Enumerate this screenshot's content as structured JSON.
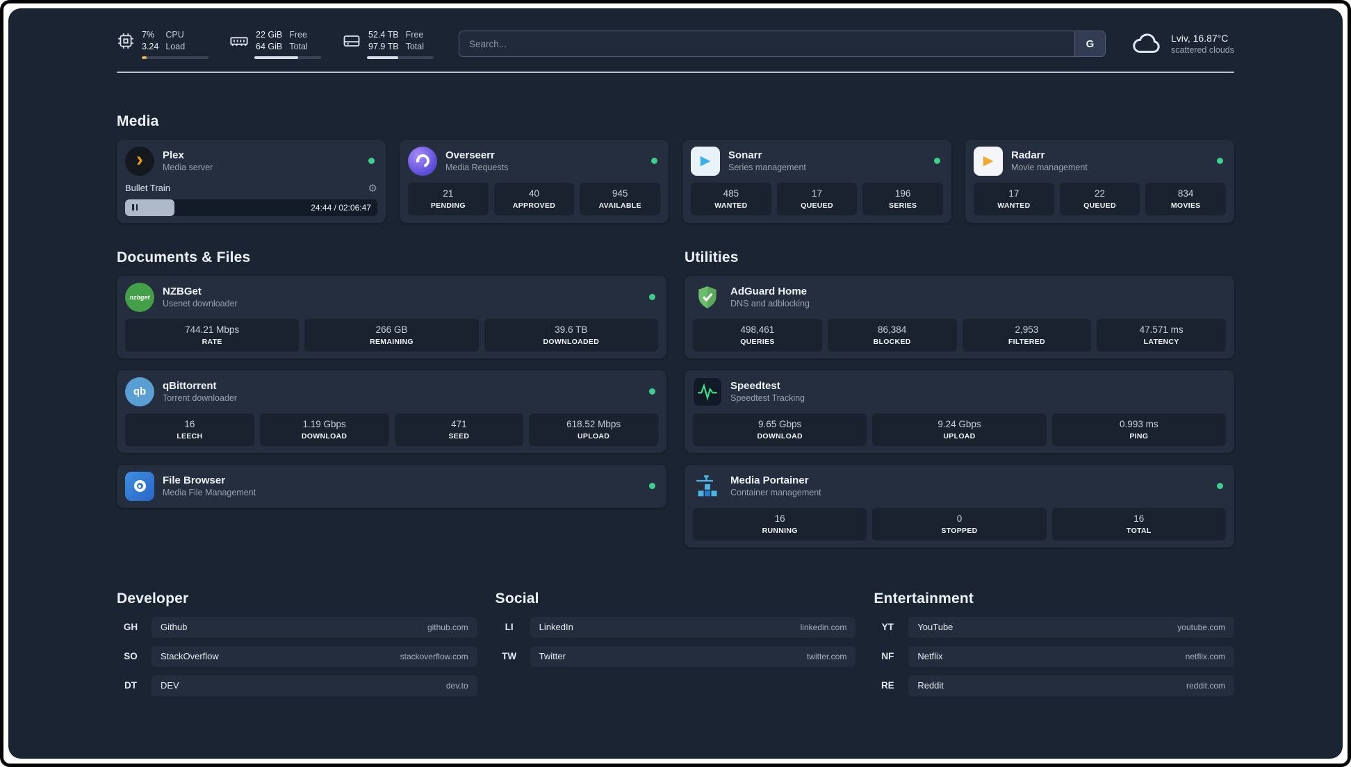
{
  "colors": {
    "status_online": "#3ecf8e",
    "accent_plex": "#e5a00d",
    "accent_sonarr": "#3bb0e8",
    "accent_radarr": "#f0a832",
    "accent_nzbget": "#43a047",
    "accent_qbittorrent": "#5a9fd4",
    "accent_adguard": "#67b86a",
    "accent_speedtest": "#3ddc84",
    "accent_portainer": "#4cb5e6",
    "cpu_bar_fill": "#e6b23c"
  },
  "header": {
    "cpu": {
      "value": "7%",
      "load": "3.24",
      "label1": "CPU",
      "label2": "Load",
      "percent": 7
    },
    "memory": {
      "value": "22 GiB",
      "total": "64 GiB",
      "label1": "Free",
      "label2": "Total",
      "percent": 66
    },
    "disk": {
      "value": "52.4 TB",
      "total": "97.9 TB",
      "label1": "Free",
      "label2": "Total",
      "percent": 47
    },
    "search": {
      "placeholder": "Search...",
      "engine": "G"
    },
    "weather": {
      "location": "Lviv, 16.87°C",
      "condition": "scattered clouds"
    }
  },
  "sections": {
    "media": "Media",
    "documents": "Documents & Files",
    "utilities": "Utilities",
    "developer": "Developer",
    "social": "Social",
    "entertainment": "Entertainment"
  },
  "media": {
    "plex": {
      "title": "Plex",
      "subtitle": "Media server",
      "now_playing": "Bullet Train",
      "time": "24:44 / 02:06:47",
      "progress": 19.5
    },
    "overseerr": {
      "title": "Overseerr",
      "subtitle": "Media Requests",
      "stats": [
        {
          "value": "21",
          "label": "PENDING"
        },
        {
          "value": "40",
          "label": "APPROVED"
        },
        {
          "value": "945",
          "label": "AVAILABLE"
        }
      ]
    },
    "sonarr": {
      "title": "Sonarr",
      "subtitle": "Series management",
      "stats": [
        {
          "value": "485",
          "label": "WANTED"
        },
        {
          "value": "17",
          "label": "QUEUED"
        },
        {
          "value": "196",
          "label": "SERIES"
        }
      ]
    },
    "radarr": {
      "title": "Radarr",
      "subtitle": "Movie management",
      "stats": [
        {
          "value": "17",
          "label": "WANTED"
        },
        {
          "value": "22",
          "label": "QUEUED"
        },
        {
          "value": "834",
          "label": "MOVIES"
        }
      ]
    }
  },
  "documents": {
    "nzbget": {
      "title": "NZBGet",
      "subtitle": "Usenet downloader",
      "icon_text": "nzbget",
      "stats": [
        {
          "value": "744.21 Mbps",
          "label": "RATE"
        },
        {
          "value": "266 GB",
          "label": "REMAINING"
        },
        {
          "value": "39.6 TB",
          "label": "DOWNLOADED"
        }
      ]
    },
    "qbittorrent": {
      "title": "qBittorrent",
      "subtitle": "Torrent downloader",
      "icon_text": "qb",
      "stats": [
        {
          "value": "16",
          "label": "LEECH"
        },
        {
          "value": "1.19 Gbps",
          "label": "DOWNLOAD"
        },
        {
          "value": "471",
          "label": "SEED"
        },
        {
          "value": "618.52 Mbps",
          "label": "UPLOAD"
        }
      ]
    },
    "filebrowser": {
      "title": "File Browser",
      "subtitle": "Media File Management"
    }
  },
  "utilities": {
    "adguard": {
      "title": "AdGuard Home",
      "subtitle": "DNS and adblocking",
      "stats": [
        {
          "value": "498,461",
          "label": "QUERIES"
        },
        {
          "value": "86,384",
          "label": "BLOCKED"
        },
        {
          "value": "2,953",
          "label": "FILTERED"
        },
        {
          "value": "47.571 ms",
          "label": "LATENCY"
        }
      ]
    },
    "speedtest": {
      "title": "Speedtest",
      "subtitle": "Speedtest Tracking",
      "stats": [
        {
          "value": "9.65 Gbps",
          "label": "DOWNLOAD"
        },
        {
          "value": "9.24 Gbps",
          "label": "UPLOAD"
        },
        {
          "value": "0.993 ms",
          "label": "PING"
        }
      ]
    },
    "portainer": {
      "title": "Media Portainer",
      "subtitle": "Container management",
      "stats": [
        {
          "value": "16",
          "label": "RUNNING"
        },
        {
          "value": "0",
          "label": "STOPPED"
        },
        {
          "value": "16",
          "label": "TOTAL"
        }
      ]
    }
  },
  "bookmarks": {
    "developer": [
      {
        "abbr": "GH",
        "name": "Github",
        "domain": "github.com"
      },
      {
        "abbr": "SO",
        "name": "StackOverflow",
        "domain": "stackoverflow.com"
      },
      {
        "abbr": "DT",
        "name": "DEV",
        "domain": "dev.to"
      }
    ],
    "social": [
      {
        "abbr": "LI",
        "name": "LinkedIn",
        "domain": "linkedin.com"
      },
      {
        "abbr": "TW",
        "name": "Twitter",
        "domain": "twitter.com"
      }
    ],
    "entertainment": [
      {
        "abbr": "YT",
        "name": "YouTube",
        "domain": "youtube.com"
      },
      {
        "abbr": "NF",
        "name": "Netflix",
        "domain": "netflix.com"
      },
      {
        "abbr": "RE",
        "name": "Reddit",
        "domain": "reddit.com"
      }
    ]
  }
}
